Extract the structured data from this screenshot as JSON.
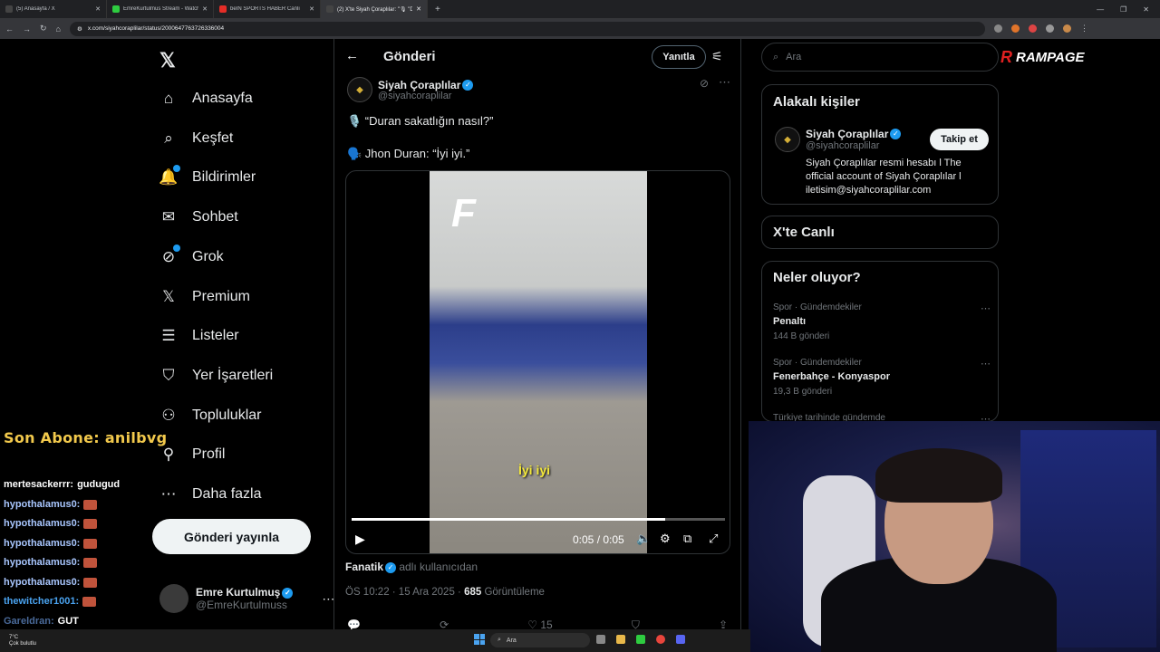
{
  "browser": {
    "tabs": [
      {
        "title": "(5) Anasayfa / X",
        "color": "#1d1d1d",
        "active": false
      },
      {
        "title": "EmreKurtulmus Stream - Watch",
        "color": "#2ecc40",
        "active": false
      },
      {
        "title": "beIN SPORTS HABER Canlı",
        "color": "#e52d27",
        "active": false
      },
      {
        "title": "(2) X'te Siyah Çoraplılar: \"🎙 \"D",
        "color": "#1d1d1d",
        "active": true
      }
    ],
    "url": "x.com/siyahcoraplilar/status/2000647763726336004"
  },
  "overlay": {
    "last_sub": "Son Abone: anilbvg",
    "chat": [
      {
        "user": "mertesackerrr:",
        "msg": "gudugud",
        "emote": false,
        "color": "#ffffff"
      },
      {
        "user": "hypothalamus0:",
        "msg": "",
        "emote": true,
        "color": "#a9c7ff"
      },
      {
        "user": "hypothalamus0:",
        "msg": "",
        "emote": true,
        "color": "#a9c7ff"
      },
      {
        "user": "hypothalamus0:",
        "msg": "",
        "emote": true,
        "color": "#a9c7ff"
      },
      {
        "user": "hypothalamus0:",
        "msg": "",
        "emote": true,
        "color": "#a9c7ff"
      },
      {
        "user": "hypothalamus0:",
        "msg": "",
        "emote": true,
        "color": "#a9c7ff"
      },
      {
        "user": "thewitcher1001:",
        "msg": "",
        "emote": true,
        "color": "#4aa3f0"
      },
      {
        "user": "Gareldran:",
        "msg": "GUT",
        "emote": false,
        "color": "#4a6a9a"
      }
    ]
  },
  "nav": {
    "items": [
      {
        "label": "Anasayfa",
        "icon": "home-icon",
        "glyph": "⌂"
      },
      {
        "label": "Keşfet",
        "icon": "search-icon",
        "glyph": "⌕"
      },
      {
        "label": "Bildirimler",
        "icon": "bell-icon",
        "glyph": "🔔"
      },
      {
        "label": "Sohbet",
        "icon": "mail-icon",
        "glyph": "✉"
      },
      {
        "label": "Grok",
        "icon": "grok-icon",
        "glyph": "⊘"
      },
      {
        "label": "Premium",
        "icon": "x-premium-icon",
        "glyph": "𝕏"
      },
      {
        "label": "Listeler",
        "icon": "list-icon",
        "glyph": "☰"
      },
      {
        "label": "Yer İşaretleri",
        "icon": "bookmark-icon",
        "glyph": "⛉"
      },
      {
        "label": "Topluluklar",
        "icon": "communities-icon",
        "glyph": "⚇"
      },
      {
        "label": "Profil",
        "icon": "profile-icon",
        "glyph": "⚲"
      },
      {
        "label": "Daha fazla",
        "icon": "more-circle-icon",
        "glyph": "⋯"
      }
    ],
    "post_button": "Gönderi yayınla",
    "account": {
      "name": "Emre Kurtulmuş",
      "handle": "@EmreKurtulmuss"
    }
  },
  "post": {
    "header_title": "Gönderi",
    "reply_button": "Yanıtla",
    "author_name": "Siyah Çoraplılar",
    "author_handle": "@siyahcoraplilar",
    "line1": "🎙️ “Duran sakatlığın nasıl?”",
    "line2": "🗣️ Jhon Duran: “İyi iyi.”",
    "video": {
      "subtitle": "İyi iyi",
      "time": "0:05 / 0:05",
      "progress": 0.84
    },
    "source_name": "Fanatik",
    "source_suffix": "adlı kullanıcıdan",
    "timestamp": "ÖS 10:22 · 15 Ara 2025 ·",
    "views": "685",
    "views_label": "Görüntüleme",
    "likes": "15"
  },
  "right": {
    "search_placeholder": "Ara",
    "brand": "RAMPAGE",
    "related_title": "Alakalı kişiler",
    "related": {
      "name": "Siyah Çoraplılar",
      "handle": "@siyahcoraplilar",
      "follow": "Takip et",
      "bio": "Siyah Çoraplılar resmi hesabı l The official account of Siyah Çoraplılar l iletisim@siyahcoraplilar.com"
    },
    "live_title": "X'te Canlı",
    "trends_title": "Neler oluyor?",
    "trends": [
      {
        "category": "Spor · Gündemdekiler",
        "title": "Penaltı",
        "count": "144 B gönderi"
      },
      {
        "category": "Spor · Gündemdekiler",
        "title": "Fenerbahçe - Konyaspor",
        "count": "19,3 B gönderi"
      },
      {
        "category": "Türkiye tarihinde gündemde",
        "title": "",
        "count": ""
      }
    ]
  },
  "taskbar": {
    "temp": "7°C",
    "weather": "Çok bulutlu",
    "search": "Ara"
  }
}
